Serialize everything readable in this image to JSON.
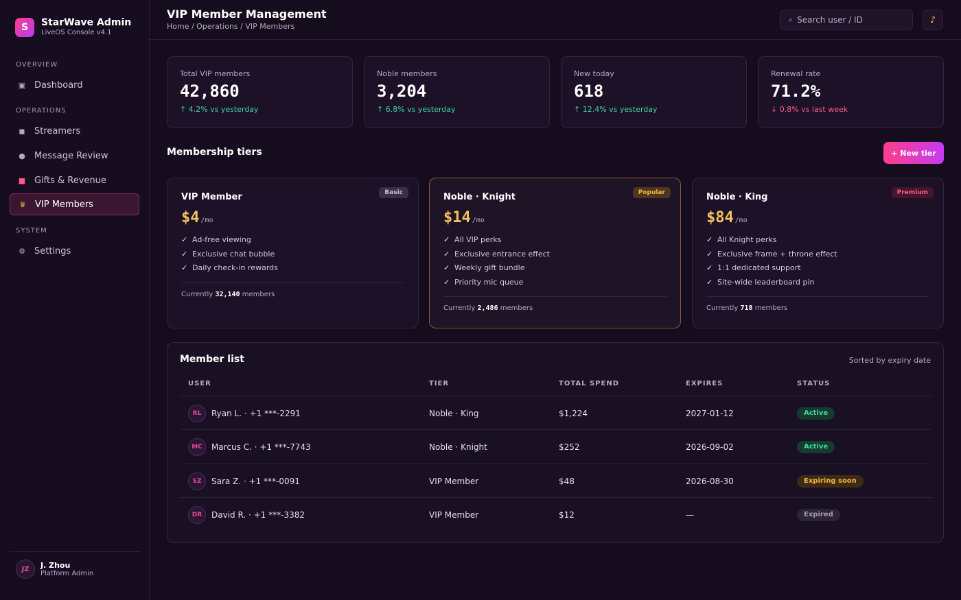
{
  "brand": {
    "logo": "S",
    "name": "StarWave Admin",
    "sub": "LiveOS Console v4.1"
  },
  "nav": {
    "sections": [
      "OVERVIEW",
      "OPERATIONS",
      "SYSTEM"
    ],
    "items": [
      {
        "label": "Dashboard",
        "icon": "dashboard-icon"
      },
      {
        "label": "Streamers",
        "icon": "camera-icon"
      },
      {
        "label": "Message Review",
        "icon": "chat-bubble-icon"
      },
      {
        "label": "Gifts & Revenue",
        "icon": "gift-icon"
      },
      {
        "label": "VIP Members",
        "icon": "crown-icon",
        "active": true
      },
      {
        "label": "Settings",
        "icon": "gear-icon"
      }
    ]
  },
  "user": {
    "initials": "JZ",
    "name": "J. Zhou",
    "role": "Platform Admin"
  },
  "header": {
    "title": "VIP Member Management",
    "breadcrumb": "Home / Operations / VIP Members",
    "search_placeholder": "Search user / ID"
  },
  "stats": [
    {
      "label": "Total VIP members",
      "value": "42,860",
      "delta": "↑ 4.2% vs yesterday",
      "trend": "up"
    },
    {
      "label": "Noble members",
      "value": "3,204",
      "delta": "↑ 6.8% vs yesterday",
      "trend": "up"
    },
    {
      "label": "New today",
      "value": "618",
      "delta": "↑ 12.4% vs yesterday",
      "trend": "up"
    },
    {
      "label": "Renewal rate",
      "value": "71.2%",
      "delta": "↓ 0.8% vs last week",
      "trend": "down"
    }
  ],
  "tiers_section": {
    "title": "Membership tiers",
    "new_button": "+ New tier"
  },
  "tiers": [
    {
      "name": "VIP Member",
      "badge": "Basic",
      "price": "$4",
      "unit": "/mo",
      "perks": [
        "Ad-free viewing",
        "Exclusive chat bubble",
        "Daily check-in rewards"
      ],
      "foot_prefix": "Currently",
      "count": "32,140",
      "foot_suffix": "members"
    },
    {
      "name": "Noble · Knight",
      "badge": "Popular",
      "price": "$14",
      "unit": "/mo",
      "perks": [
        "All VIP perks",
        "Exclusive entrance effect",
        "Weekly gift bundle",
        "Priority mic queue"
      ],
      "foot_prefix": "Currently",
      "count": "2,486",
      "foot_suffix": "members"
    },
    {
      "name": "Noble · King",
      "badge": "Premium",
      "price": "$84",
      "unit": "/mo",
      "perks": [
        "All Knight perks",
        "Exclusive frame + throne effect",
        "1:1 dedicated support",
        "Site-wide leaderboard pin"
      ],
      "foot_prefix": "Currently",
      "count": "718",
      "foot_suffix": "members"
    }
  ],
  "members": {
    "title": "Member list",
    "sort_note": "Sorted by expiry date",
    "columns": [
      "USER",
      "TIER",
      "TOTAL SPEND",
      "EXPIRES",
      "STATUS"
    ],
    "rows": [
      {
        "initials": "RL",
        "user": "Ryan L. · +1 ***-2291",
        "tier": "Noble · King",
        "spend": "$1,224",
        "expires": "2027-01-12",
        "status": "Active",
        "status_type": "active"
      },
      {
        "initials": "MC",
        "user": "Marcus C. · +1 ***-7743",
        "tier": "Noble · Knight",
        "spend": "$252",
        "expires": "2026-09-02",
        "status": "Active",
        "status_type": "active"
      },
      {
        "initials": "SZ",
        "user": "Sara Z. · +1 ***-0091",
        "tier": "VIP Member",
        "spend": "$48",
        "expires": "2026-08-30",
        "status": "Expiring soon",
        "status_type": "expiring"
      },
      {
        "initials": "DR",
        "user": "David R. · +1 ***-3382",
        "tier": "VIP Member",
        "spend": "$12",
        "expires": "—",
        "status": "Expired",
        "status_type": "expired"
      }
    ]
  },
  "colors": {
    "accent": "#ff3d8b",
    "gold": "#f5c15a",
    "up": "#3fd6a4",
    "down": "#ff5c8a"
  }
}
